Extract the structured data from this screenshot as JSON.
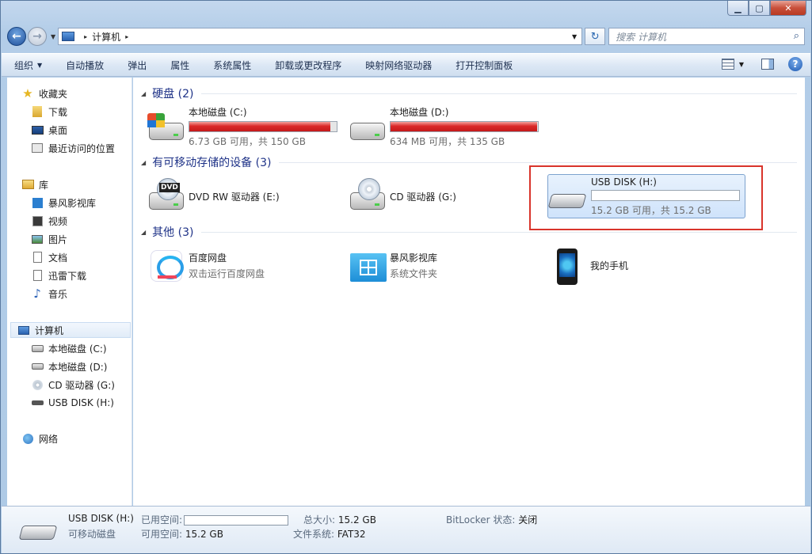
{
  "window": {
    "caption_min": "▁",
    "caption_max": "▢",
    "caption_close": "✕"
  },
  "address": {
    "breadcrumb_root_sep": "▸",
    "location": "计算机",
    "after_sep": "▸",
    "search_placeholder": "搜索 计算机"
  },
  "toolbar": {
    "organize": "组织",
    "autoplay": "自动播放",
    "eject": "弹出",
    "properties": "属性",
    "system_properties": "系统属性",
    "uninstall": "卸载或更改程序",
    "map_drive": "映射网络驱动器",
    "control_panel": "打开控制面板",
    "help": "?"
  },
  "sidebar": {
    "favorites": "收藏夹",
    "downloads": "下载",
    "desktop": "桌面",
    "recent": "最近访问的位置",
    "libraries": "库",
    "storm_video": "暴风影视库",
    "videos": "视频",
    "pictures": "图片",
    "documents": "文档",
    "xunlei": "迅雷下载",
    "music": "音乐",
    "computer": "计算机",
    "drive_c": "本地磁盘 (C:)",
    "drive_d": "本地磁盘 (D:)",
    "drive_g": "CD 驱动器 (G:)",
    "drive_h": "USB DISK (H:)",
    "network": "网络"
  },
  "groups": {
    "hdd": "硬盘 (2)",
    "removable": "有可移动存储的设备 (3)",
    "other": "其他 (3)"
  },
  "items": {
    "c": {
      "name": "本地磁盘 (C:)",
      "info": "6.73 GB 可用，共 150 GB",
      "used_fraction": 0.955
    },
    "d": {
      "name": "本地磁盘 (D:)",
      "info": "634 MB 可用，共 135 GB",
      "used_fraction": 0.995
    },
    "e": {
      "name": "DVD RW 驱动器 (E:)",
      "icon_label": "DVD"
    },
    "g": {
      "name": "CD 驱动器 (G:)"
    },
    "h": {
      "name": "USB DISK (H:)",
      "info": "15.2 GB 可用，共 15.2 GB",
      "used_fraction": 0.0
    },
    "baidu": {
      "name": "百度网盘",
      "sub": "双击运行百度网盘"
    },
    "storm": {
      "name": "暴风影视库",
      "sub": "系统文件夹"
    },
    "phone": {
      "name": "我的手机"
    }
  },
  "details": {
    "name": "USB DISK (H:)",
    "type": "可移动磁盘",
    "used_label": "已用空间:",
    "free_label": "可用空间:",
    "free_value": "15.2 GB",
    "total_label": "总大小:",
    "total_value": "15.2 GB",
    "fs_label": "文件系统:",
    "fs_value": "FAT32",
    "bitlocker_label": "BitLocker 状态:",
    "bitlocker_value": "关闭"
  },
  "colors": {
    "selection_box": "#d9342b",
    "drive_bar_full": "#da2828"
  }
}
